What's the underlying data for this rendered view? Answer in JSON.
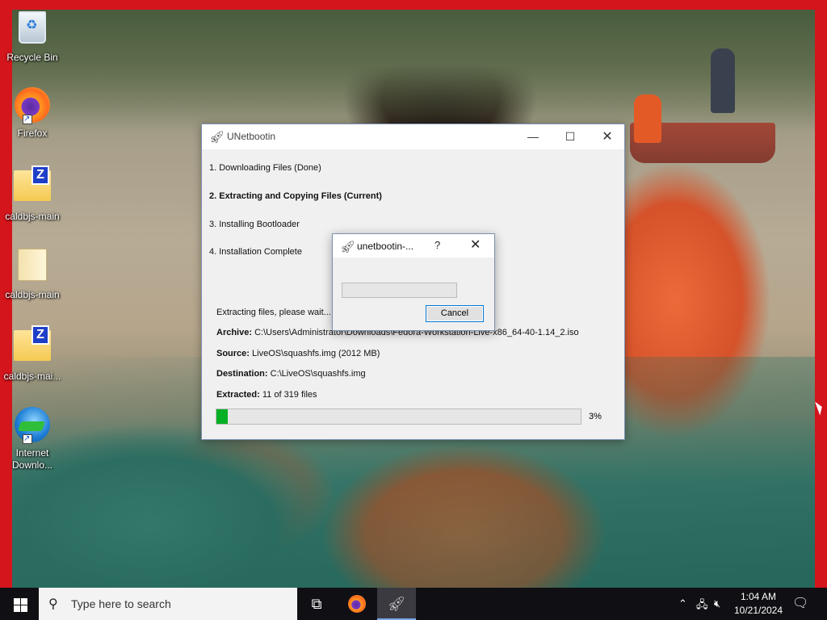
{
  "desktop": {
    "icons": [
      {
        "label": "Recycle Bin",
        "icon": "recycle-bin-icon"
      },
      {
        "label": "Firefox",
        "icon": "firefox-icon"
      },
      {
        "label": "caldbjs-main",
        "icon": "zip-folder-icon"
      },
      {
        "label": "caldbjs-main",
        "icon": "folder-icon"
      },
      {
        "label": "caldbjs-mai...",
        "icon": "zip-folder-icon"
      },
      {
        "label": "Internet\nDownlo...",
        "icon": "internet-download-manager-icon"
      }
    ],
    "border_color": "#d4151c"
  },
  "main_window": {
    "title": "UNetbootin",
    "controls": {
      "minimize": "—",
      "maximize": "☐",
      "close": "✕"
    },
    "steps": [
      "1. Downloading Files (Done)",
      "2. Extracting and Copying Files (Current)",
      "3. Installing Bootloader",
      "4. Installation Complete"
    ],
    "status": "Extracting files, please wait...",
    "archive_label": "Archive:",
    "archive_value": "C:\\Users\\Administrator\\Downloads\\Fedora-Workstation-Live-x86_64-40-1.14_2.iso",
    "source_label": "Source:",
    "source_value": "LiveOS\\squashfs.img (2012 MB)",
    "destination_label": "Destination:",
    "destination_value": "C:\\LiveOS\\squashfs.img",
    "extracted_label": "Extracted:",
    "extracted_value": "11 of 319 files",
    "progress_percent_text": "3%",
    "progress_fraction": 0.03
  },
  "dialog": {
    "title": "unetbootin-...",
    "help": "?",
    "close": "✕",
    "progress_fraction": 0,
    "cancel_label": "Cancel"
  },
  "taskbar": {
    "search_placeholder": "Type here to search",
    "time": "1:04 AM",
    "date": "10/21/2024",
    "accent": "#06b025"
  }
}
